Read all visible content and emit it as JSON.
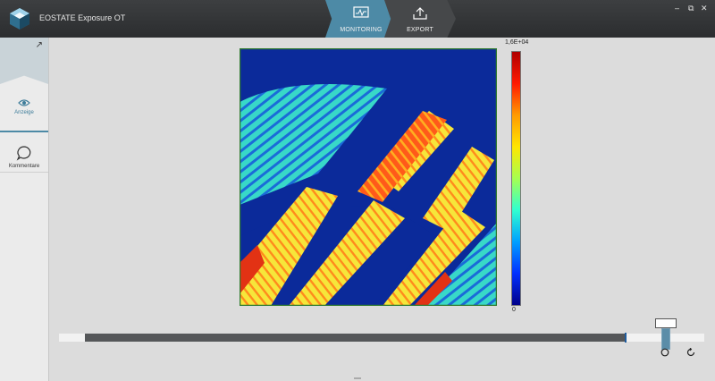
{
  "app": {
    "title": "EOSTATE Exposure OT"
  },
  "tabs": [
    {
      "label": "MONITORING",
      "icon": "monitor-icon",
      "active": true
    },
    {
      "label": "EXPORT",
      "icon": "upload-icon",
      "active": false
    }
  ],
  "sidebar": {
    "items": [
      {
        "label": "Anzeige",
        "icon": "eye-icon",
        "active": true
      },
      {
        "label": "Kommentare",
        "icon": "speech-bubble-icon",
        "active": false
      }
    ]
  },
  "colorbar": {
    "max": "1,6E+04",
    "min": "0"
  },
  "timeline": {
    "tooltip": "⁠"
  },
  "colors": {
    "accent": "#4d8aa6",
    "titlebar": "#2b2d2f",
    "heat_background": "#0b2a9a"
  }
}
